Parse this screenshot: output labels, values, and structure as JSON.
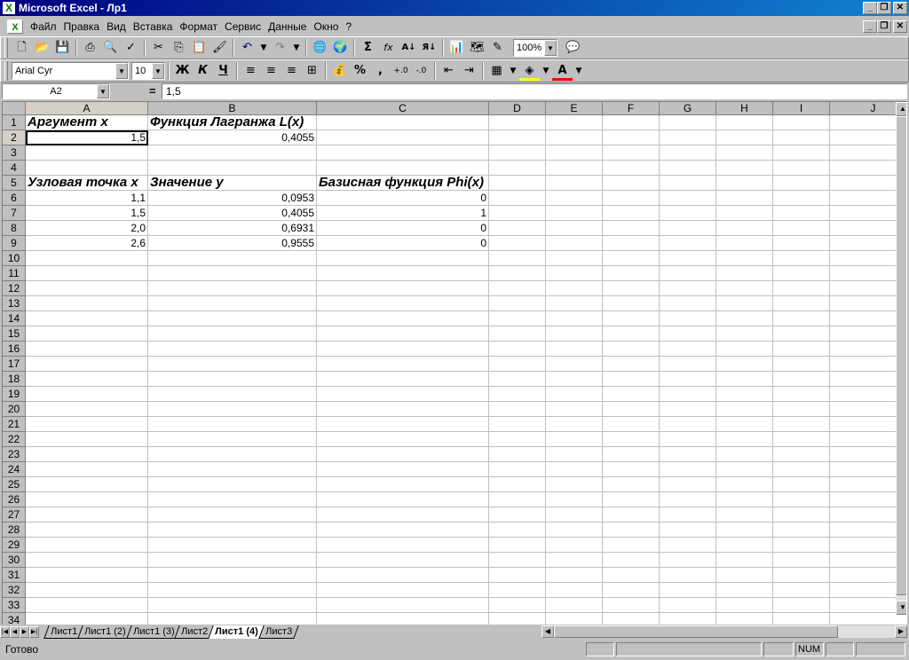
{
  "window": {
    "title": "Microsoft Excel - Лр1"
  },
  "menu": {
    "items": [
      "Файл",
      "Правка",
      "Вид",
      "Вставка",
      "Формат",
      "Сервис",
      "Данные",
      "Окно",
      "?"
    ]
  },
  "toolbar": {
    "zoom": "100%",
    "font": "Arial Cyr",
    "size": "10",
    "bold": "Ж",
    "italic": "К",
    "underline": "Ч",
    "percent": "%",
    "comma": ",",
    "sigma": "Σ",
    "fx": "fx"
  },
  "formula": {
    "cell_ref": "A2",
    "equals": "=",
    "value": "1,5"
  },
  "columns": [
    "A",
    "B",
    "C",
    "D",
    "E",
    "F",
    "G",
    "H",
    "I",
    "J"
  ],
  "rows": [
    "1",
    "2",
    "3",
    "4",
    "5",
    "6",
    "7",
    "8",
    "9",
    "10",
    "11",
    "12",
    "13",
    "14",
    "15",
    "16",
    "17",
    "18",
    "19",
    "20",
    "21",
    "22",
    "23",
    "24",
    "25",
    "26",
    "27",
    "28",
    "29",
    "30",
    "31",
    "32",
    "33",
    "34"
  ],
  "cells": {
    "a1": "Аргумент x",
    "b1": "Функция Лагранжа L(x)",
    "a2": "1,5",
    "b2": "0,4055",
    "a5": "Узловая точка x",
    "b5": "Значение y",
    "c5": "Базисная функция Phi(x)",
    "a6": "1,1",
    "b6": "0,0953",
    "c6": "0",
    "a7": "1,5",
    "b7": "0,4055",
    "c7": "1",
    "a8": "2,0",
    "b8": "0,6931",
    "c8": "0",
    "a9": "2,6",
    "b9": "0,9555",
    "c9": "0"
  },
  "sheets": [
    "Лист1",
    "Лист1 (2)",
    "Лист1 (3)",
    "Лист2",
    "Лист1 (4)",
    "Лист3"
  ],
  "active_sheet": "Лист1 (4)",
  "status": {
    "text": "Готово",
    "num": "NUM"
  }
}
